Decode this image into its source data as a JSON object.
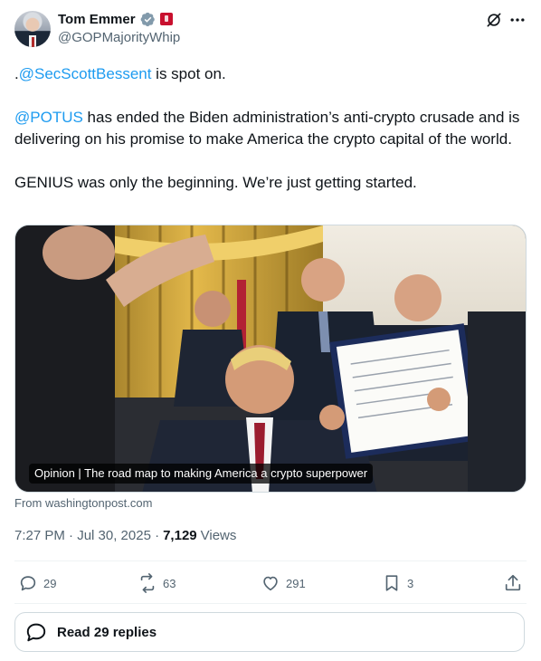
{
  "author": {
    "name": "Tom Emmer",
    "handle": "@GOPMajorityWhip"
  },
  "tweet": {
    "line1_prefix": ".",
    "line1_mention": "@SecScottBessent",
    "line1_rest": " is spot on.",
    "para2_mention": "@POTUS",
    "para2_rest": " has ended the Biden administration’s anti-crypto crusade and is delivering on his promise to make America the crypto capital of the world.",
    "para3": "GENIUS was only the beginning. We’re just getting started."
  },
  "card": {
    "caption": "Opinion | The road map to making America a crypto superpower",
    "source": "From washingtonpost.com"
  },
  "meta": {
    "timestamp": "7:27 PM · Jul 30, 2025 · ",
    "views_count": "7,129",
    "views_label": "Views"
  },
  "actions": {
    "reply_count": "29",
    "retweet_count": "63",
    "like_count": "291",
    "bookmark_count": "3"
  },
  "read_replies": "Read 29 replies",
  "colors": {
    "link": "#1d9bf0",
    "muted": "#536471",
    "text": "#0f1419",
    "verified_badge": "#829aab",
    "flag": "#c8102e"
  },
  "icons": [
    "verified-badge-icon",
    "flag-icon",
    "grok-icon",
    "more-icon",
    "reply-icon",
    "retweet-icon",
    "like-icon",
    "bookmark-icon",
    "share-icon",
    "replies-bubble-icon"
  ]
}
